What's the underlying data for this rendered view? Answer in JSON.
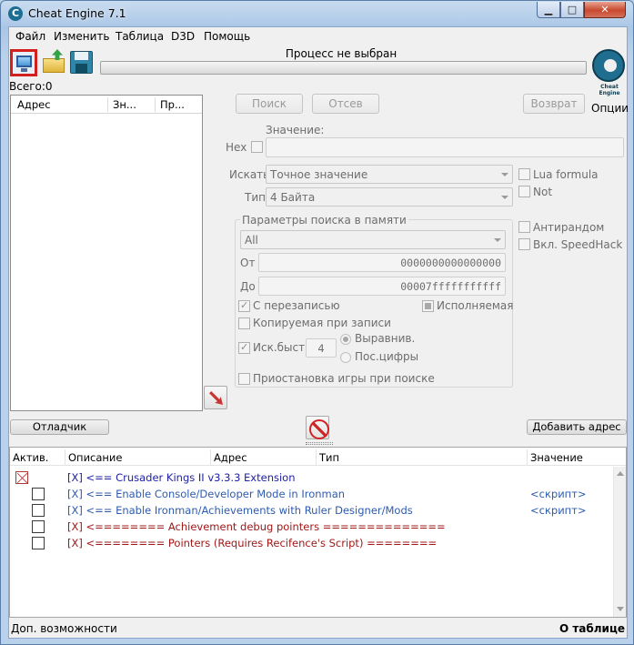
{
  "window": {
    "title": "Cheat Engine 7.1",
    "buttons": {
      "minimize": "▁",
      "maximize": "□",
      "close": "✕"
    }
  },
  "menu": [
    "Файл",
    "Изменить",
    "Таблица",
    "D3D",
    "Помощь"
  ],
  "process": {
    "label": "Процесс не выбран",
    "progress": 0
  },
  "logo": {
    "text": "Cheat Engine"
  },
  "options_label": "Опции",
  "found_count": "Всего:0",
  "address_list": {
    "columns": [
      "Адрес",
      "Зн...",
      "Пр..."
    ]
  },
  "scan_buttons": {
    "first": "Поиск",
    "next": "Отсев",
    "undo": "Возврат"
  },
  "value": {
    "label": "Значение:",
    "hex_label": "Hex",
    "text": ""
  },
  "scan_type": {
    "label": "Искать",
    "selected": "Точное значение"
  },
  "value_type": {
    "label": "Тип",
    "selected": "4 Байта"
  },
  "right_options": {
    "lua_formula": "Lua formula",
    "not": "Not",
    "unrandomizer": "Антирандом",
    "speedhack": "Вкл. SpeedHack"
  },
  "memory_scan": {
    "title": "Параметры поиска в памяти",
    "region": "All",
    "from_label": "От",
    "from_value": "0000000000000000",
    "to_label": "До",
    "to_value": "00007fffffffffff",
    "writable": "С перезаписью",
    "executable": "Исполняемая",
    "copy_on_write": "Копируемая при записи",
    "fast_scan": "Иск.быст.",
    "fast_scan_value": "4",
    "alignment": "Выравнив.",
    "last_digits": "Пос.цифры",
    "pause_game": "Приостановка игры при поиске"
  },
  "buttons": {
    "debugger": "Отладчик",
    "add_address": "Добавить адрес"
  },
  "cheat_table": {
    "columns": [
      "Актив.",
      "Описание",
      "Адрес",
      "Тип",
      "Значение"
    ],
    "rows": [
      {
        "desc": "[X] <== Crusader Kings II v3.3.3 Extension",
        "value": "",
        "color": "#2020a8",
        "indent": 0,
        "checked": true
      },
      {
        "desc": "[X] <== Enable Console/Developer Mode in Ironman",
        "value": "<скрипт>",
        "color": "#2e5bb0",
        "indent": 1,
        "checked": false
      },
      {
        "desc": "[X] <== Enable Ironman/Achievements with Ruler Designer/Mods",
        "value": "<скрипт>",
        "color": "#2e5bb0",
        "indent": 1,
        "checked": false
      },
      {
        "desc": "[X] <======== Achievement debug pointers ==============",
        "value": "",
        "color": "#a01818",
        "indent": 1,
        "checked": false
      },
      {
        "desc": "[X] <======== Pointers (Requires Recifence's Script) ========",
        "value": "",
        "color": "#a01818",
        "indent": 1,
        "checked": false
      }
    ]
  },
  "status": {
    "left": "Доп. возможности",
    "right": "О таблице"
  }
}
